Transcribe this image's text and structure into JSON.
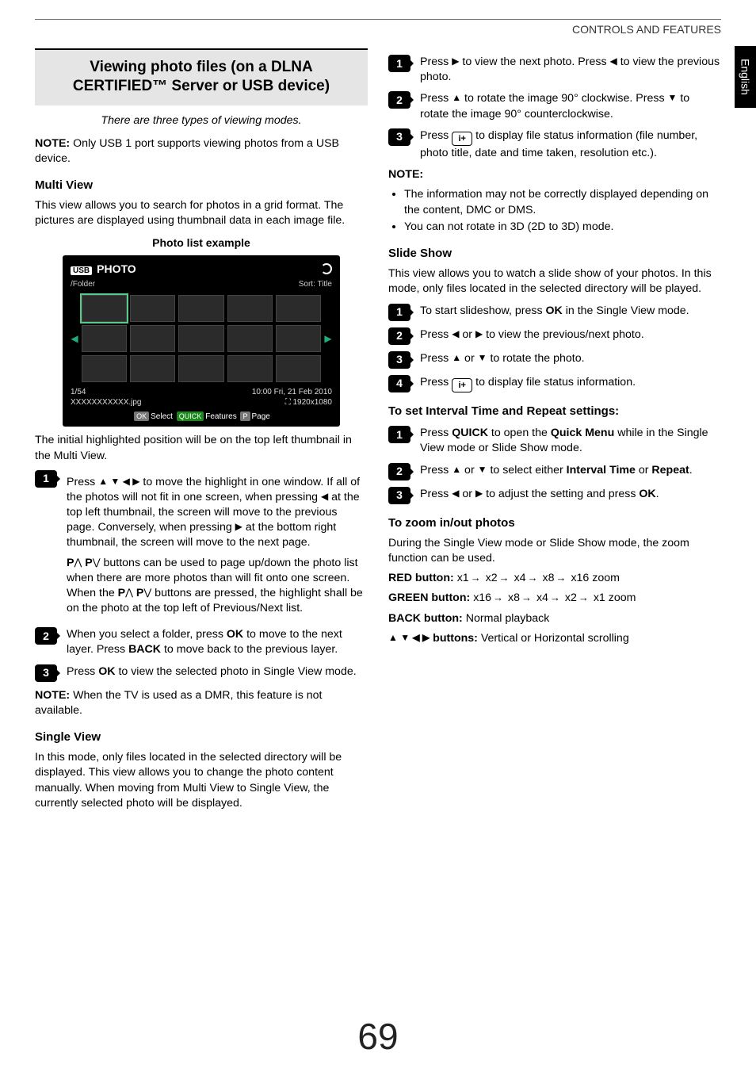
{
  "header": {
    "title": "CONTROLS AND FEATURES"
  },
  "sideTab": {
    "label": "English"
  },
  "pageNumber": "69",
  "left": {
    "sectionTitle": "Viewing photo files (on a DLNA CERTIFIED™ Server or USB device)",
    "intro": "There are three types of viewing modes.",
    "noteLabel": "NOTE:",
    "note1": " Only USB 1 port supports viewing photos from a USB device.",
    "multiView": {
      "heading": "Multi View",
      "body": "This view allows you to search for photos in a grid format. The pictures are displayed using thumbnail data in each image file.",
      "caption": "Photo list example"
    },
    "photolist": {
      "title": "PHOTO",
      "path": "/Folder",
      "sort": "Sort: Title",
      "count": "1/54",
      "filename": "XXXXXXXXXXX.jpg",
      "timestamp": "10:00 Fri, 21 Feb 2010",
      "res": "1920x1080",
      "barOk": "OK",
      "barSelect": "Select",
      "barQuick": "QUICK",
      "barFeatures": "Features",
      "barP": "P",
      "barPage": "Page",
      "usbIcon": "USB"
    },
    "afterList": "The initial highlighted position will be on the top left thumbnail in the Multi View.",
    "steps": [
      {
        "n": "1",
        "text1": "Press ",
        "arrows1": "▲ ▼ ◀ ▶",
        "text2": " to move the highlight in one window. If all of the photos will not fit in one screen, when pressing ",
        "arrL": "◀",
        "text3": " at the top left thumbnail, the screen will move to the previous page. Conversely, when pressing ",
        "arrR": "▶",
        "text4": " at the bottom right thumbnail, the screen will move to the next page.",
        "para2a": "P",
        "pUp": "⋀",
        "para2b": " P",
        "pDn": "⋁",
        "para2c": " buttons can be used to page up/down the photo list when there are more photos than will fit onto one screen. When the ",
        "para2d": "P",
        "para2e": " P",
        "para2f": " buttons are pressed, the highlight shall be on the photo at the top left of Previous/Next list."
      },
      {
        "n": "2",
        "text1": "When you select a folder, press ",
        "ok": "OK",
        "text2": " to move to the next layer. Press ",
        "back": "BACK",
        "text3": " to move back to the previous layer."
      },
      {
        "n": "3",
        "text1": "Press ",
        "ok": "OK",
        "text2": " to view the selected photo in Single View mode."
      }
    ],
    "note2Label": "NOTE:",
    "note2": " When the TV is used as a DMR, this feature is not available.",
    "singleView": {
      "heading": "Single View",
      "body": "In this mode, only files located in the selected directory will be displayed. This view allows you to change the photo content manually. When moving from Multi View to Single View, the currently selected photo will be displayed."
    }
  },
  "right": {
    "svSteps": [
      {
        "n": "1",
        "t1": "Press ",
        "arrR": "▶",
        "t2": " to view the next photo. Press ",
        "arrL": "◀",
        "t3": " to view the previous photo."
      },
      {
        "n": "2",
        "t1": "Press ",
        "arrU": "▲",
        "t2": " to rotate the image 90° clockwise. Press ",
        "arrD": "▼",
        "t3": " to rotate the image 90° counterclockwise."
      },
      {
        "n": "3",
        "t1": "Press ",
        "iplus": "i+",
        "t2": " to display file status information (file number, photo title, date and time taken, resolution etc.)."
      }
    ],
    "noteLabel": "NOTE:",
    "noteBullets": [
      "The information may not be correctly displayed depending on the content, DMC or DMS.",
      "You can not rotate in 3D (2D to 3D) mode."
    ],
    "slideShow": {
      "heading": "Slide Show",
      "body": "This view allows you to watch a slide show of your photos. In this mode, only files located in the selected directory will be played.",
      "steps": [
        {
          "n": "1",
          "t1": "To start slideshow, press ",
          "ok": "OK",
          "t2": " in the Single View mode."
        },
        {
          "n": "2",
          "t1": "Press ",
          "arrL": "◀",
          "orWord": " or ",
          "arrR": "▶",
          "t2": " to view the previous/next photo."
        },
        {
          "n": "3",
          "t1": "Press ",
          "arrU": "▲",
          "orWord": " or ",
          "arrD": "▼",
          "t2": " to rotate the photo."
        },
        {
          "n": "4",
          "t1": "Press ",
          "iplus": "i+",
          "t2": " to display file status information."
        }
      ]
    },
    "intervalHeading": "To set Interval Time and Repeat settings:",
    "intervalSteps": [
      {
        "n": "1",
        "t1": "Press ",
        "quick": "QUICK",
        "t2": " to open the ",
        "qm": "Quick Menu",
        "t3": " while in the Single View mode or Slide Show mode."
      },
      {
        "n": "2",
        "t1": "Press ",
        "arrU": "▲",
        "orWord": " or ",
        "arrD": "▼",
        "t2": " to select either ",
        "it": "Interval Time",
        "orWord2": " or ",
        "rp": "Repeat",
        "t3": "."
      },
      {
        "n": "3",
        "t1": "Press ",
        "arrL": "◀",
        "orWord": " or ",
        "arrR": "▶",
        "t2": " to adjust the setting and press ",
        "ok": "OK",
        "t3": "."
      }
    ],
    "zoom": {
      "heading": "To zoom in/out photos",
      "body": "During the Single View mode or Slide Show mode, the zoom function can be used.",
      "redLabel": "RED button:",
      "redSeq": [
        "x1",
        "x2",
        "x4",
        "x8",
        "x16 zoom"
      ],
      "greenLabel": "GREEN button:",
      "greenSeq": [
        "x16",
        "x8",
        "x4",
        "x2",
        "x1 zoom"
      ],
      "backLabel": "BACK button:",
      "backText": " Normal playback",
      "arrowsLabelArrows": "▲ ▼ ◀ ▶",
      "arrowsLabel": " buttons:",
      "arrowsText": " Vertical or Horizontal scrolling"
    }
  }
}
